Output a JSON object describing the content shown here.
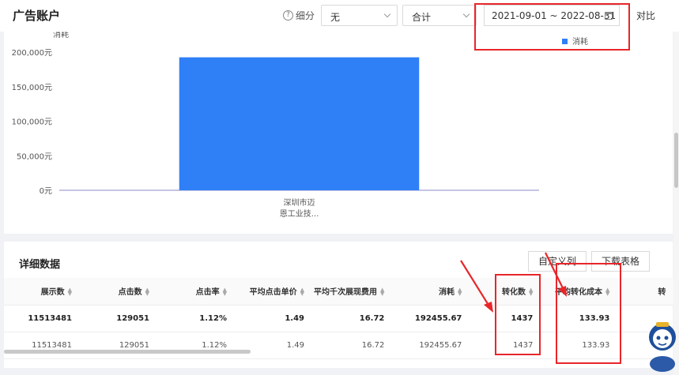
{
  "header": {
    "title": "广告账户",
    "breakdown_label": "细分",
    "breakdown_value": "无",
    "aggregate_value": "合计",
    "date_range": "2021-09-01 ~ 2022-08-31",
    "compare_label": "对比"
  },
  "chart_data": {
    "type": "bar",
    "ylabel": "消耗",
    "categories": [
      "深圳市迈恩工业技..."
    ],
    "category_lines": [
      "深圳市迈",
      "恩工业技..."
    ],
    "series": [
      {
        "name": "消耗",
        "values": [
          192455.67
        ],
        "color": "#2f7ff7"
      }
    ],
    "ylim": [
      0,
      200000
    ],
    "yticks": [
      "0元",
      "50,000元",
      "100,000元",
      "150,000元",
      "200,000元"
    ],
    "legend_position": "top-right",
    "grid": false
  },
  "details": {
    "title": "详细数据",
    "custom_columns_label": "自定义列",
    "download_label": "下载表格",
    "columns": [
      "展示数",
      "点击数",
      "点击率",
      "平均点击单价",
      "平均千次展现费用",
      "消耗",
      "转化数",
      "平均转化成本",
      "转"
    ],
    "rows": [
      [
        "11513481",
        "129051",
        "1.12%",
        "1.49",
        "16.72",
        "192455.67",
        "1437",
        "133.93",
        ""
      ],
      [
        "11513481",
        "129051",
        "1.12%",
        "1.49",
        "16.72",
        "192455.67",
        "1437",
        "133.93",
        ""
      ]
    ]
  },
  "colors": {
    "accent": "#2f7ff7",
    "annotation": "#e8262a"
  }
}
